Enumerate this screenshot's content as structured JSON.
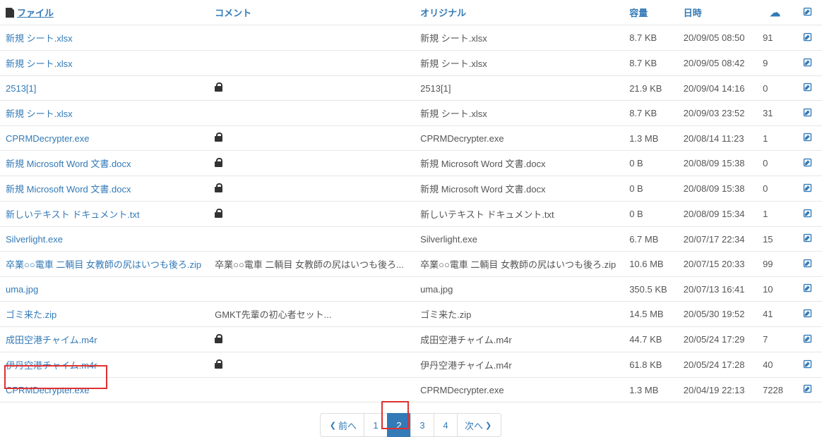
{
  "headers": {
    "file": "ファイル",
    "comment": "コメント",
    "original": "オリジナル",
    "size": "容量",
    "date": "日時"
  },
  "rows": [
    {
      "file": "新規 シート.xlsx",
      "comment": "",
      "locked": false,
      "original": "新規 シート.xlsx",
      "size": "8.7 KB",
      "date": "20/09/05 08:50",
      "dl": "91"
    },
    {
      "file": "新規 シート.xlsx",
      "comment": "",
      "locked": false,
      "original": "新規 シート.xlsx",
      "size": "8.7 KB",
      "date": "20/09/05 08:42",
      "dl": "9"
    },
    {
      "file": "2513[1]",
      "comment": "",
      "locked": true,
      "original": "2513[1]",
      "size": "21.9 KB",
      "date": "20/09/04 14:16",
      "dl": "0"
    },
    {
      "file": "新規 シート.xlsx",
      "comment": "",
      "locked": false,
      "original": "新規 シート.xlsx",
      "size": "8.7 KB",
      "date": "20/09/03 23:52",
      "dl": "31"
    },
    {
      "file": "CPRMDecrypter.exe",
      "comment": "",
      "locked": true,
      "original": "CPRMDecrypter.exe",
      "size": "1.3 MB",
      "date": "20/08/14 11:23",
      "dl": "1"
    },
    {
      "file": "新規 Microsoft Word 文書.docx",
      "comment": "",
      "locked": true,
      "original": "新規 Microsoft Word 文書.docx",
      "size": "0 B",
      "date": "20/08/09 15:38",
      "dl": "0"
    },
    {
      "file": "新規 Microsoft Word 文書.docx",
      "comment": "",
      "locked": true,
      "original": "新規 Microsoft Word 文書.docx",
      "size": "0 B",
      "date": "20/08/09 15:38",
      "dl": "0"
    },
    {
      "file": "新しいテキスト ドキュメント.txt",
      "comment": "",
      "locked": true,
      "original": "新しいテキスト ドキュメント.txt",
      "size": "0 B",
      "date": "20/08/09 15:34",
      "dl": "1"
    },
    {
      "file": "Silverlight.exe",
      "comment": "",
      "locked": false,
      "original": "Silverlight.exe",
      "size": "6.7 MB",
      "date": "20/07/17 22:34",
      "dl": "15"
    },
    {
      "file": "卒業○○電車 二輌目 女教師の尻はいつも後ろ.zip",
      "comment": "卒業○○電車 二輌目 女教師の尻はいつも後ろ...",
      "locked": false,
      "original": "卒業○○電車 二輌目 女教師の尻はいつも後ろ.zip",
      "size": "10.6 MB",
      "date": "20/07/15 20:33",
      "dl": "99"
    },
    {
      "file": "uma.jpg",
      "comment": "",
      "locked": false,
      "original": "uma.jpg",
      "size": "350.5 KB",
      "date": "20/07/13 16:41",
      "dl": "10"
    },
    {
      "file": "ゴミ来た.zip",
      "comment": "GMKT先輩の初心者セット...",
      "locked": false,
      "original": "ゴミ来た.zip",
      "size": "14.5 MB",
      "date": "20/05/30 19:52",
      "dl": "41"
    },
    {
      "file": "成田空港チャイム.m4r",
      "comment": "",
      "locked": true,
      "original": "成田空港チャイム.m4r",
      "size": "44.7 KB",
      "date": "20/05/24 17:29",
      "dl": "7"
    },
    {
      "file": "伊丹空港チャイム.m4r",
      "comment": "",
      "locked": true,
      "original": "伊丹空港チャイム.m4r",
      "size": "61.8 KB",
      "date": "20/05/24 17:28",
      "dl": "40"
    },
    {
      "file": "CPRMDecrypter.exe",
      "comment": "",
      "locked": false,
      "original": "CPRMDecrypter.exe",
      "size": "1.3 MB",
      "date": "20/04/19 22:13",
      "dl": "7228"
    }
  ],
  "pagination": {
    "prev": "前へ",
    "next": "次へ",
    "pages": [
      "1",
      "2",
      "3",
      "4"
    ],
    "active": "2"
  }
}
